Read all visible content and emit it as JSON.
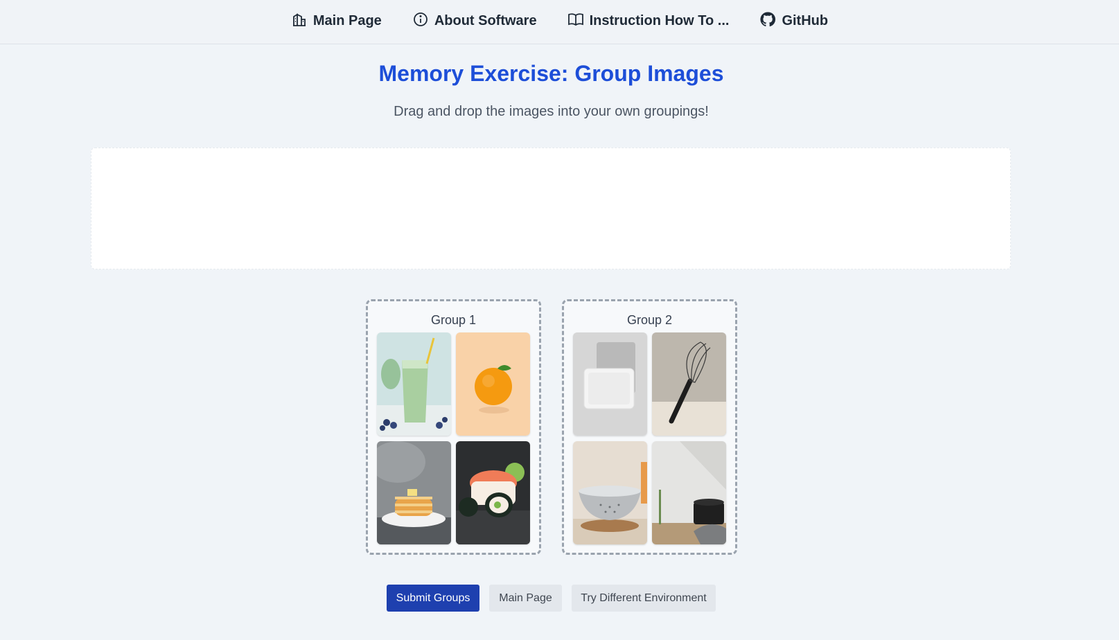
{
  "nav": {
    "items": [
      {
        "label": "Main Page",
        "icon": "building-icon"
      },
      {
        "label": "About Software",
        "icon": "info-icon"
      },
      {
        "label": "Instruction How To ...",
        "icon": "book-icon"
      },
      {
        "label": "GitHub",
        "icon": "github-icon"
      }
    ]
  },
  "page": {
    "title": "Memory Exercise: Group Images",
    "subtitle": "Drag and drop the images into your own groupings!"
  },
  "groups": [
    {
      "title": "Group 1",
      "images": [
        "green smoothie",
        "orange",
        "pancakes",
        "sushi roll"
      ]
    },
    {
      "title": "Group 2",
      "images": [
        "white dish",
        "whisk",
        "colander",
        "pot"
      ]
    }
  ],
  "buttons": {
    "submit": "Submit Groups",
    "main_page": "Main Page",
    "try_different": "Try Different Environment"
  },
  "colors": {
    "title": "#1d4ed8",
    "primary_button": "#1e40af",
    "background": "#f0f4f8"
  }
}
